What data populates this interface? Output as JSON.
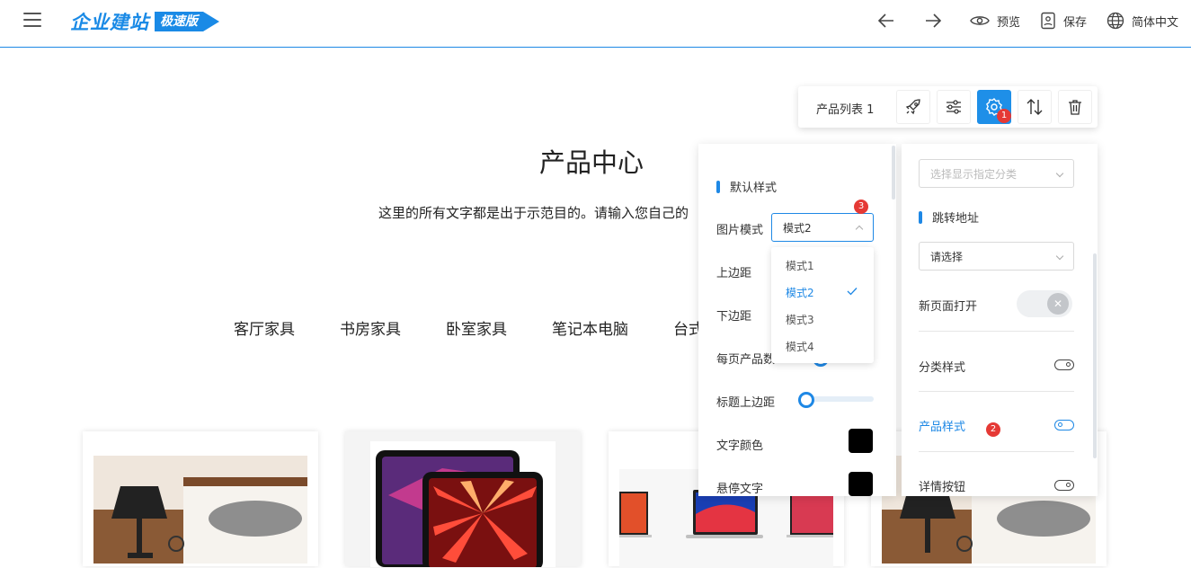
{
  "header": {
    "logo_main": "企业建站",
    "logo_badge": "极速版",
    "actions": {
      "back": "",
      "forward": "",
      "preview": "预览",
      "save": "保存",
      "language": "简体中文"
    }
  },
  "section": {
    "title": "产品中心",
    "description": "这里的所有文字都是出于示范目的。请输入您自己的"
  },
  "categories": [
    "客厅家具",
    "书房家具",
    "卧室家具",
    "笔记本电脑",
    "台式"
  ],
  "component_toolbar": {
    "name": "产品列表 1",
    "badge": "1",
    "icons": [
      "rocket-icon",
      "sliders-icon",
      "gear-icon",
      "sort-icon",
      "trash-icon"
    ]
  },
  "panel_left": {
    "section_default": "默认样式",
    "image_mode_label": "图片模式",
    "image_mode_value": "模式2",
    "badge": "3",
    "top_spacing": "上边距",
    "bottom_spacing": "下边距",
    "per_page": "每页产品数",
    "title_top_spacing": "标题上边距",
    "title_top_spacing_value": 0,
    "text_color": "文字颜色",
    "text_color_value": "#000000",
    "hover_text": "悬停文字",
    "hover_text_value": "#000000",
    "dropdown_options": [
      "模式1",
      "模式2",
      "模式3",
      "模式4"
    ],
    "dropdown_selected": "模式2"
  },
  "panel_right": {
    "category_select_placeholder": "选择显示指定分类",
    "jump_section": "跳转地址",
    "jump_select_value": "请选择",
    "new_page": "新页面打开",
    "new_page_on": false,
    "category_style": "分类样式",
    "product_style": "产品样式",
    "product_style_badge": "2",
    "detail_button": "详情按钮"
  },
  "colors": {
    "accent": "#1e88e5",
    "badge_red": "#e53935"
  }
}
